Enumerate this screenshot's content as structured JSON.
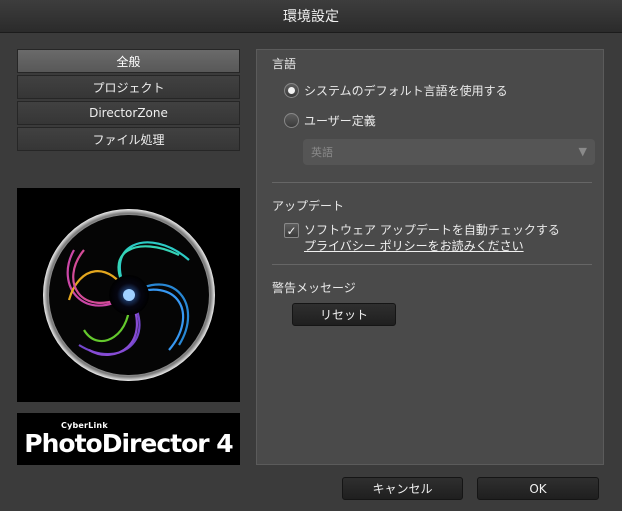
{
  "window": {
    "title": "環境設定"
  },
  "nav": {
    "items": [
      {
        "label": "全般",
        "active": true
      },
      {
        "label": "プロジェクト",
        "active": false
      },
      {
        "label": "DirectorZone",
        "active": false
      },
      {
        "label": "ファイル処理",
        "active": false
      }
    ]
  },
  "brand": {
    "company": "CyberLink",
    "product": "PhotoDirector 4"
  },
  "language": {
    "title": "言語",
    "option_default": "システムのデフォルト言語を使用する",
    "option_custom": "ユーザー定義",
    "selected_option": "default",
    "select_value": "英語"
  },
  "update": {
    "title": "アップデート",
    "auto_check_label": "ソフトウェア アップデートを自動チェックする",
    "auto_check_checked": true,
    "privacy_link": "プライバシー ポリシーをお読みください"
  },
  "warnings": {
    "title": "警告メッセージ",
    "reset_label": "リセット"
  },
  "footer": {
    "cancel_label": "キャンセル",
    "ok_label": "OK"
  }
}
